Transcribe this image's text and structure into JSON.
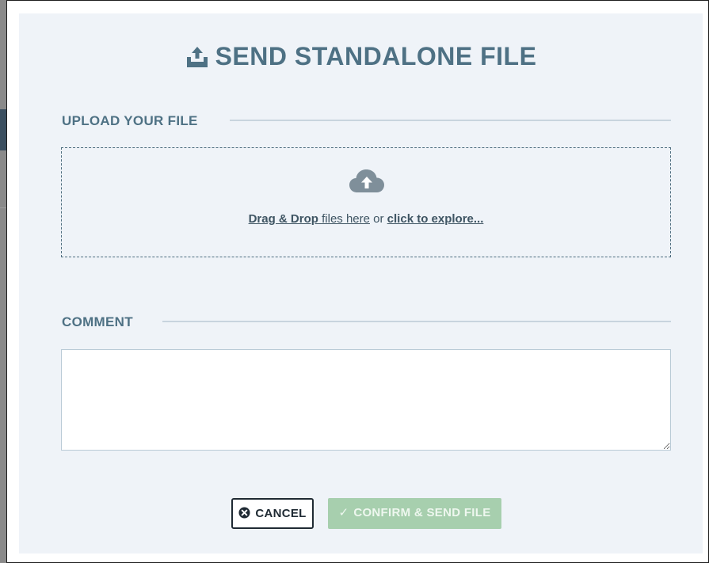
{
  "dialog": {
    "title": "SEND STANDALONE FILE",
    "title_icon": "upload-tray-icon"
  },
  "upload_section": {
    "label": "UPLOAD YOUR FILE",
    "dropzone": {
      "icon": "cloud-upload-icon",
      "drag_drop_link": "Drag & Drop",
      "middle_text": " files here",
      "or_text": " or ",
      "explore_link": "click to explore..."
    }
  },
  "comment_section": {
    "label": "COMMENT",
    "value": "",
    "placeholder": ""
  },
  "buttons": {
    "cancel_label": "CANCEL",
    "cancel_icon": "close-circle-icon",
    "confirm_label": "CONFIRM & SEND FILE",
    "confirm_icon": "check-icon"
  },
  "colors": {
    "accent": "#4e7184",
    "panel_background": "#eff3f8",
    "confirm_disabled": "#a7cfae",
    "dropzone_border": "#4e6d7f"
  }
}
